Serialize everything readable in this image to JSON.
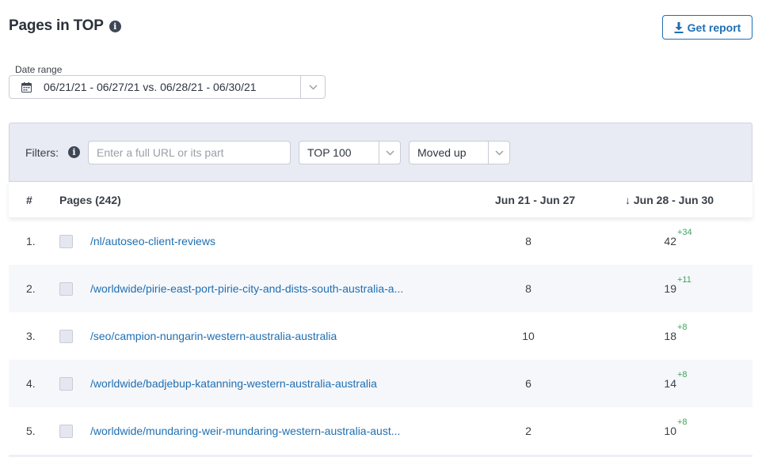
{
  "header": {
    "title": "Pages in TOP",
    "info_icon": "i",
    "report_button": "Get report"
  },
  "date_range": {
    "label": "Date range",
    "value": "06/21/21 - 06/27/21 vs. 06/28/21 - 06/30/21"
  },
  "filters": {
    "label": "Filters:",
    "info_icon": "i",
    "url_placeholder": "Enter a full URL or its part",
    "top_select": "TOP 100",
    "movement_select": "Moved up"
  },
  "table": {
    "col_num": "#",
    "col_pages": "Pages (242)",
    "col_period1": "Jun 21 - Jun 27",
    "col_period2": "↓ Jun 28 - Jun 30",
    "rows": [
      {
        "num": "1.",
        "url": "/nl/autoseo-client-reviews",
        "p1": "8",
        "p2": "42",
        "delta": "+34"
      },
      {
        "num": "2.",
        "url": "/worldwide/pirie-east-port-pirie-city-and-dists-south-australia-a...",
        "p1": "8",
        "p2": "19",
        "delta": "+11"
      },
      {
        "num": "3.",
        "url": "/seo/campion-nungarin-western-australia-australia",
        "p1": "10",
        "p2": "18",
        "delta": "+8"
      },
      {
        "num": "4.",
        "url": "/worldwide/badjebup-katanning-western-australia-australia",
        "p1": "6",
        "p2": "14",
        "delta": "+8"
      },
      {
        "num": "5.",
        "url": "/worldwide/mundaring-weir-mundaring-western-australia-aust...",
        "p1": "2",
        "p2": "10",
        "delta": "+8"
      }
    ]
  },
  "colors": {
    "accent": "#1f6fb2",
    "positive": "#3ca55c",
    "panel": "#e8ebf4"
  }
}
